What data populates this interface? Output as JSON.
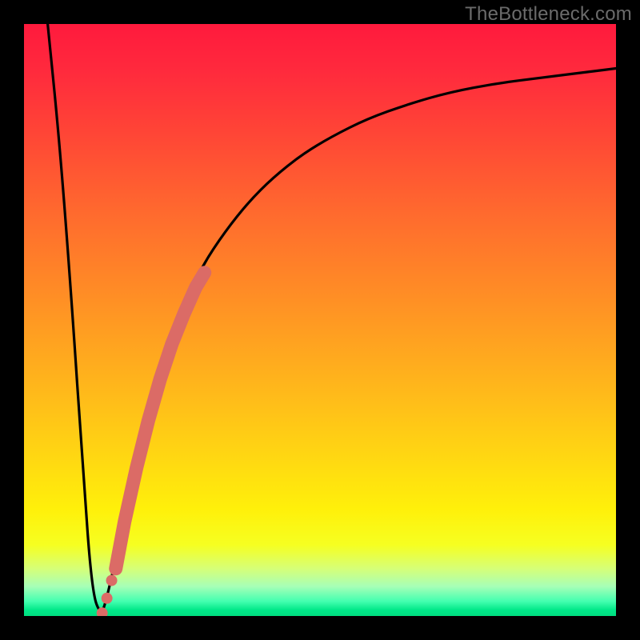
{
  "watermark": "TheBottleneck.com",
  "chart_data": {
    "type": "line",
    "title": "",
    "xlabel": "",
    "ylabel": "",
    "xlim": [
      0,
      100
    ],
    "ylim": [
      0,
      100
    ],
    "grid": false,
    "legend": false,
    "series": [
      {
        "name": "bottleneck-curve",
        "color": "#000000",
        "x": [
          4,
          6,
          8,
          10,
          11.5,
          13,
          14,
          16,
          18,
          21,
          24,
          27,
          30,
          34,
          38,
          42,
          47,
          52,
          58,
          65,
          72,
          80,
          88,
          96,
          100
        ],
        "y": [
          100,
          80,
          54,
          24,
          4,
          0,
          3,
          12,
          22,
          34,
          44,
          52,
          59,
          65,
          70,
          74,
          78,
          81,
          84,
          86.5,
          88.5,
          90,
          91,
          92,
          92.5
        ]
      },
      {
        "name": "thick-segment",
        "color": "#db6b66",
        "type": "trail",
        "x": [
          15.5,
          17,
          19,
          21,
          23,
          25,
          27,
          29,
          30.5
        ],
        "y": [
          8,
          16,
          25,
          33,
          40,
          46,
          51,
          55.5,
          58
        ]
      },
      {
        "name": "dots",
        "color": "#db6b66",
        "type": "scatter",
        "x": [
          13.2,
          14.0,
          14.8
        ],
        "y": [
          0.5,
          3.0,
          6.0
        ]
      }
    ]
  }
}
